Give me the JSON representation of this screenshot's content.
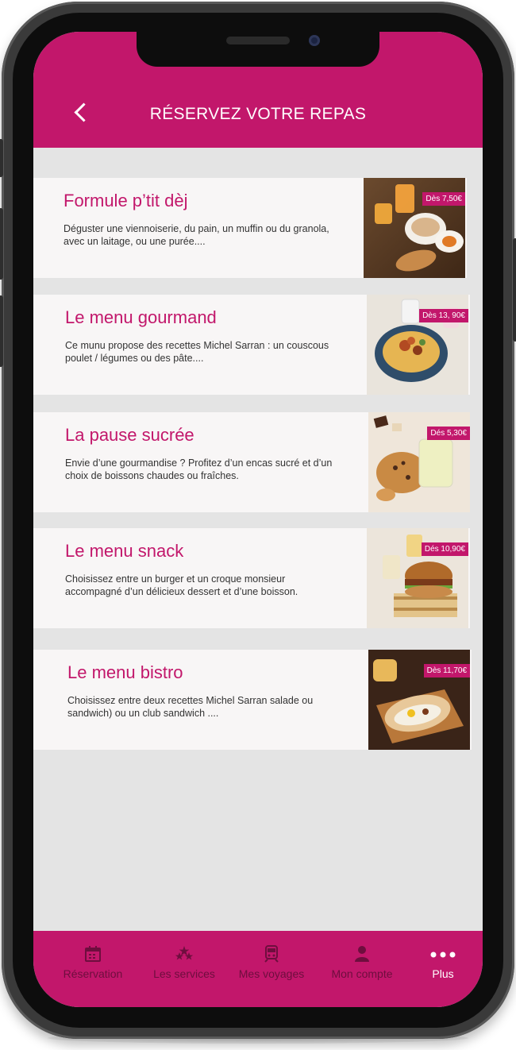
{
  "header": {
    "title": "RÉSERVEZ VOTRE REPAS"
  },
  "menus": [
    {
      "title": "Formule p’tit dèj",
      "description": "Déguster une viennoiserie, du pain, un muffin ou du granola, avec un laitage, ou une purée....",
      "price": "Dès 7,50€"
    },
    {
      "title": "Le menu gourmand",
      "description": "Ce munu propose des recettes Michel Sarran : un couscous poulet / légumes ou des pâte....",
      "price": "Dès 13, 90€"
    },
    {
      "title": "La pause sucrée",
      "description": "Envie d’une gourmandise ? Profitez d’un encas sucré et d’un choix de boissons chaudes ou fraîches.",
      "price": "Dés 5,30€"
    },
    {
      "title": "Le menu snack",
      "description": "Choisissez entre un burger et un croque monsieur accompagné d’un délicieux dessert et d’une boisson.",
      "price": "Dés 10,90€"
    },
    {
      "title": "Le menu bistro",
      "description": "Choisissez entre deux recettes Michel Sarran salade ou sandwich) ou un club sandwich ....",
      "price": "Dès 11,70€"
    }
  ],
  "tabbar": {
    "items": [
      {
        "label": "Réservation",
        "icon": "calendar-icon"
      },
      {
        "label": "Les services",
        "icon": "stars-icon"
      },
      {
        "label": "Mes voyages",
        "icon": "train-icon"
      },
      {
        "label": "Mon compte",
        "icon": "person-icon"
      },
      {
        "label": "Plus",
        "icon": "more-dots-icon",
        "active": true
      }
    ]
  },
  "colors": {
    "accent": "#c2176b",
    "background": "#e4e4e4",
    "card": "#f8f6f6",
    "inactive_tab": "#6e0e3e"
  }
}
